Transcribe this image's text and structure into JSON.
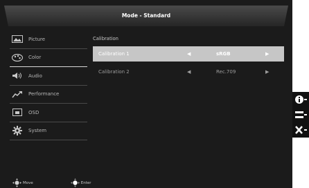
{
  "header": {
    "title": "Mode - Standard"
  },
  "sidebar": {
    "items": [
      {
        "label": "Picture",
        "icon": "picture-icon"
      },
      {
        "label": "Color",
        "icon": "palette-icon"
      },
      {
        "label": "Audio",
        "icon": "speaker-icon"
      },
      {
        "label": "Performance",
        "icon": "performance-icon"
      },
      {
        "label": "OSD",
        "icon": "osd-icon"
      },
      {
        "label": "System",
        "icon": "gear-icon"
      }
    ],
    "active": "Color"
  },
  "main": {
    "section_title": "Calibration",
    "rows": [
      {
        "label": "Calibration 1",
        "value": "sRGB",
        "left_arrow": "◀",
        "right_arrow": "▶"
      },
      {
        "label": "Calibration 2",
        "value": "Rec.709",
        "left_arrow": "◀",
        "right_arrow": "▶"
      }
    ]
  },
  "footer": {
    "move_label": "Move",
    "enter_label": "Enter"
  },
  "right_panel": {
    "buttons": [
      {
        "icon": "info-icon"
      },
      {
        "icon": "menu-icon"
      },
      {
        "icon": "close-icon"
      }
    ]
  }
}
